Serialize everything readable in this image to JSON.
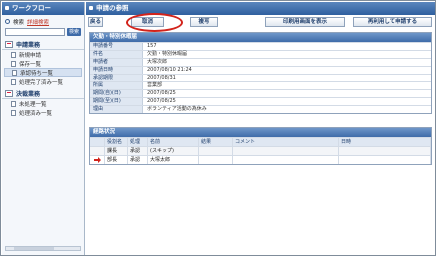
{
  "sidebar": {
    "title": "ワークフロー",
    "search_label": "検索",
    "advanced_search": "詳細検索",
    "search_button": "検索",
    "sections": [
      {
        "title": "申請業務",
        "items": [
          "新規申請",
          "保存一覧",
          "承認待ち一覧",
          "処理完了済み一覧"
        ]
      },
      {
        "title": "決裁業務",
        "items": [
          "未処理一覧",
          "処理済み一覧"
        ]
      }
    ],
    "active_item": "承認待ち一覧"
  },
  "main": {
    "title": "申請の参照",
    "toolbar": {
      "back": "戻る",
      "withdraw": "取消",
      "copy": "複写",
      "print_view": "印刷用画面を表示",
      "reuse_apply": "再利用して申請する"
    },
    "request": {
      "title": "欠勤・特別休暇届",
      "fields": [
        {
          "label": "申請番号",
          "value": "157"
        },
        {
          "label": "件名",
          "value": "欠勤・特別休暇届"
        },
        {
          "label": "申請者",
          "value": "大塚次郎"
        },
        {
          "label": "申請日時",
          "value": "2007/08/10 21:24"
        },
        {
          "label": "承認期限",
          "value": "2007/08/31"
        },
        {
          "label": "所属",
          "value": "営業部"
        },
        {
          "label": "期間(自)(日)",
          "value": "2007/08/25"
        },
        {
          "label": "期間(至)(日)",
          "value": "2007/08/25"
        },
        {
          "label": "理由",
          "value": "ボランティア活動の為休み"
        }
      ]
    },
    "route": {
      "title": "経路状況",
      "columns": [
        "",
        "役割名",
        "処理",
        "名前",
        "結果",
        "コメント",
        "日時"
      ],
      "rows": [
        {
          "role": "課長",
          "action": "承認",
          "name": "(スキップ)",
          "result": "",
          "comment": "",
          "date": "",
          "current": false
        },
        {
          "role": "部長",
          "action": "承認",
          "name": "大塚太郎",
          "result": "",
          "comment": "",
          "date": "",
          "current": true
        }
      ]
    }
  },
  "colors": {
    "header": "#2f5f9f",
    "highlight_circle": "#d2231b",
    "label_bg": "#dfe7f2"
  }
}
